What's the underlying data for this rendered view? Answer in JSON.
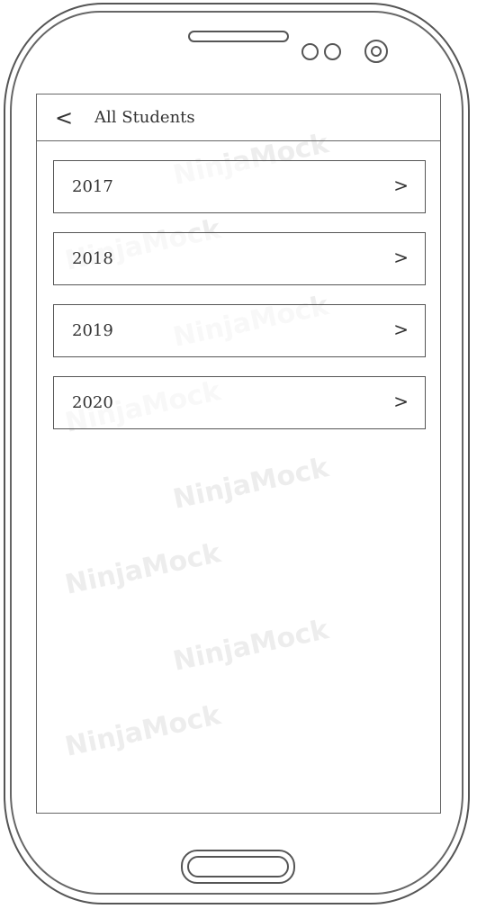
{
  "header": {
    "back_icon": "<",
    "title": "All Students"
  },
  "years": [
    {
      "label": "2017",
      "chevron": ">"
    },
    {
      "label": "2018",
      "chevron": ">"
    },
    {
      "label": "2019",
      "chevron": ">"
    },
    {
      "label": "2020",
      "chevron": ">"
    }
  ],
  "watermark": "NinjaMock"
}
